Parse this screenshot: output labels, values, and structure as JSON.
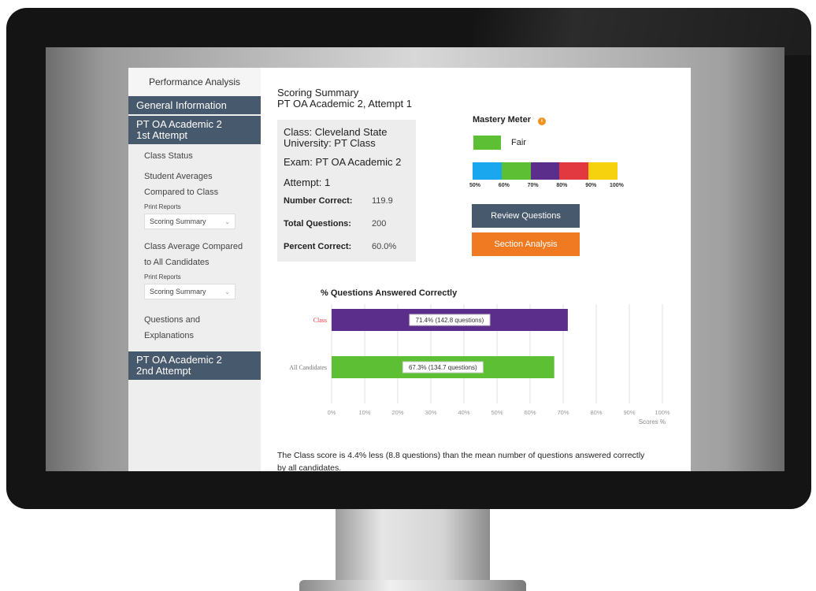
{
  "sidebar": {
    "header": "Performance Analysis",
    "items": [
      {
        "label": "General Information"
      },
      {
        "label1": "PT OA Academic 2",
        "label2": "1st Attempt"
      }
    ],
    "links": {
      "class_status": "Class Status",
      "student_averages_1": "Student Averages",
      "student_averages_2": "Compared to Class",
      "print_reports_1": "Print Reports",
      "select1": "Scoring Summary",
      "class_average_1": "Class Average Compared",
      "class_average_2": "to All Candidates",
      "print_reports_2": "Print Reports",
      "select2": "Scoring Summary",
      "questions_1": "Questions and",
      "questions_2": "Explanations"
    },
    "second_attempt_1": "PT OA Academic 2",
    "second_attempt_2": "2nd Attempt"
  },
  "main": {
    "title_line1": "Scoring Summary",
    "title_line2": "PT OA Academic 2, Attempt 1",
    "info": {
      "class_line1": "Class: Cleveland State",
      "class_line2": "University: PT Class",
      "exam": "Exam: PT OA Academic 2",
      "attempt": "Attempt: 1",
      "rows": [
        {
          "label": "Number Correct:",
          "value": "119.9"
        },
        {
          "label": "Total Questions:",
          "value": "200"
        },
        {
          "label": "Percent Correct:",
          "value": "60.0%"
        }
      ]
    },
    "mastery": {
      "title": "Mastery Meter",
      "info_icon": "i",
      "level": "Fair",
      "level_color": "#5cbf34",
      "segments": [
        "#1aa7ee",
        "#5cbf34",
        "#5b2e8c",
        "#e2383f",
        "#f5d10e"
      ],
      "ticks": [
        "50%",
        "60%",
        "70%",
        "80%",
        "90%",
        "100%"
      ]
    },
    "buttons": {
      "review": "Review Questions",
      "section": "Section Analysis"
    },
    "summary_line1": "The Class score is 4.4% less (8.8 questions) than the mean number of questions answered correctly",
    "summary_line2": "by all candidates."
  },
  "chart_data": {
    "type": "bar",
    "orientation": "horizontal",
    "title": "% Questions Answered Correctly",
    "categories": [
      "Class",
      "All Candidates"
    ],
    "values": [
      71.4,
      67.3
    ],
    "data_labels": [
      "71.4% (142.8 questions)",
      "67.3% (134.7 questions)"
    ],
    "colors": [
      "#5b2e8c",
      "#5cbf34"
    ],
    "label_colors": [
      "#e2383f",
      "#777777"
    ],
    "xlim": [
      0,
      100
    ],
    "x_ticks": [
      "0%",
      "10%",
      "20%",
      "30%",
      "40%",
      "50%",
      "60%",
      "70%",
      "80%",
      "90%",
      "100%"
    ],
    "xlabel": "Scores %",
    "grid": true
  }
}
